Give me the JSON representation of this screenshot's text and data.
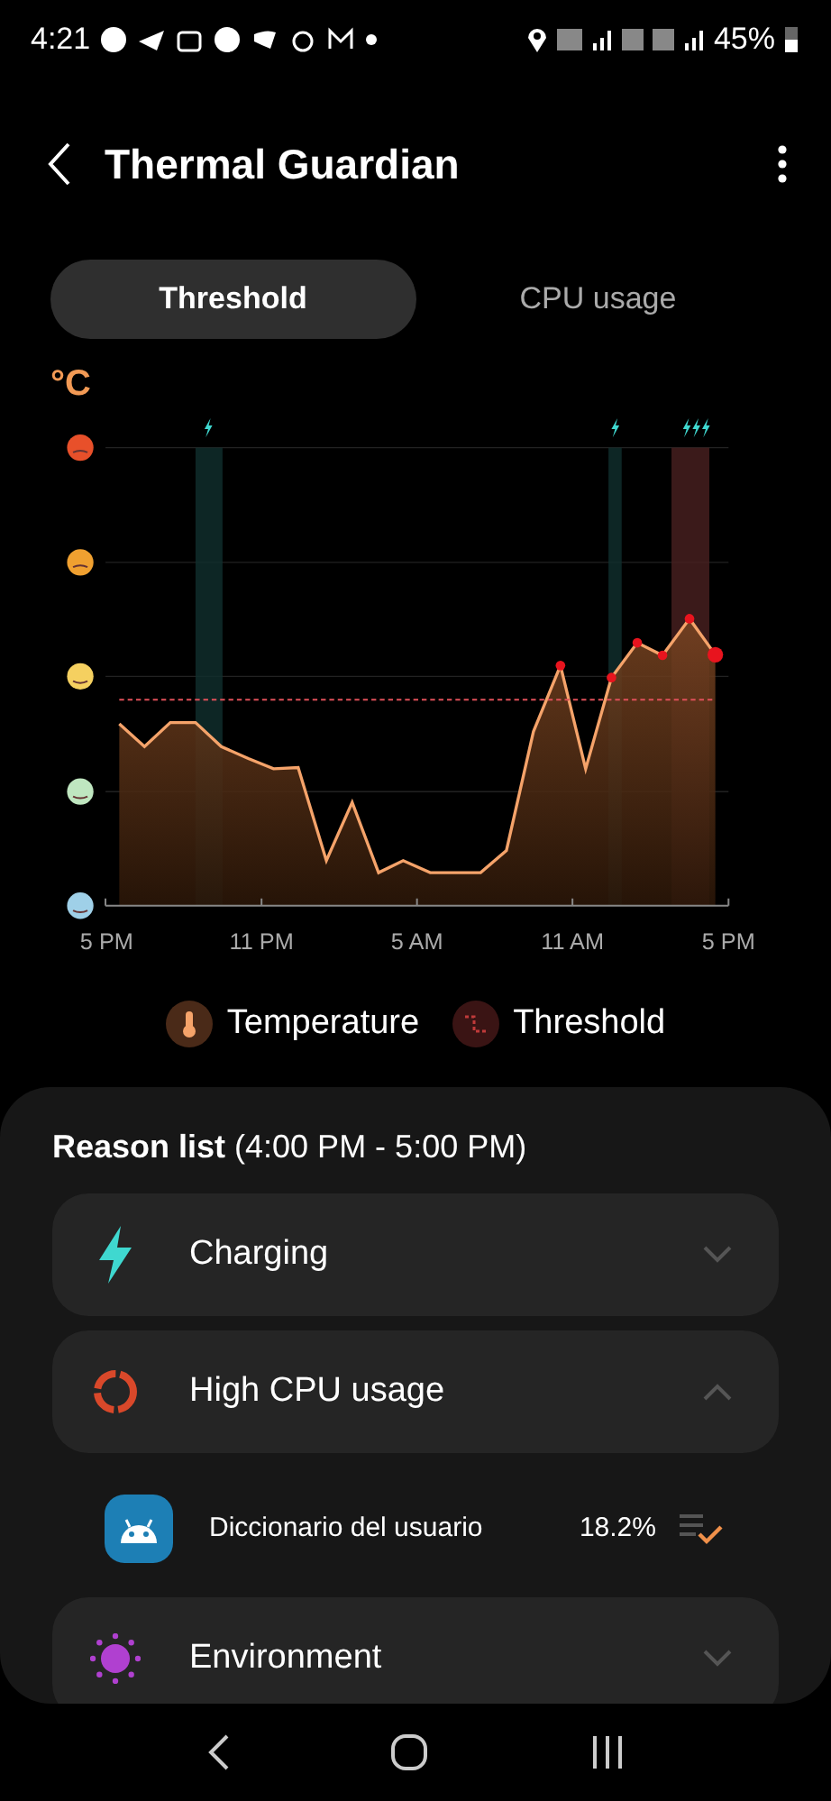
{
  "status_bar": {
    "time": "4:21",
    "battery": "45%"
  },
  "header": {
    "title": "Thermal Guardian"
  },
  "tabs": [
    {
      "label": "Threshold",
      "selected": true
    },
    {
      "label": "CPU usage",
      "selected": false
    }
  ],
  "chart": {
    "unit": "°C",
    "x_labels": [
      "5 PM",
      "11 PM",
      "5 AM",
      "11 AM",
      "5 PM"
    ]
  },
  "legend": [
    {
      "kind": "temperature",
      "label": "Temperature"
    },
    {
      "kind": "threshold",
      "label": "Threshold"
    }
  ],
  "reason_list": {
    "title": "**Reason list** (4:00 PM - 5:00 PM)",
    "items": [
      {
        "kind": "charging",
        "label": "Charging",
        "expanded": false
      },
      {
        "kind": "cpu",
        "label": "High CPU usage",
        "expanded": true,
        "apps": [
          {
            "name": "Diccionario del usuario",
            "usage": "18.2%"
          }
        ]
      },
      {
        "kind": "environment",
        "label": "Environment",
        "expanded": false
      }
    ]
  }
}
